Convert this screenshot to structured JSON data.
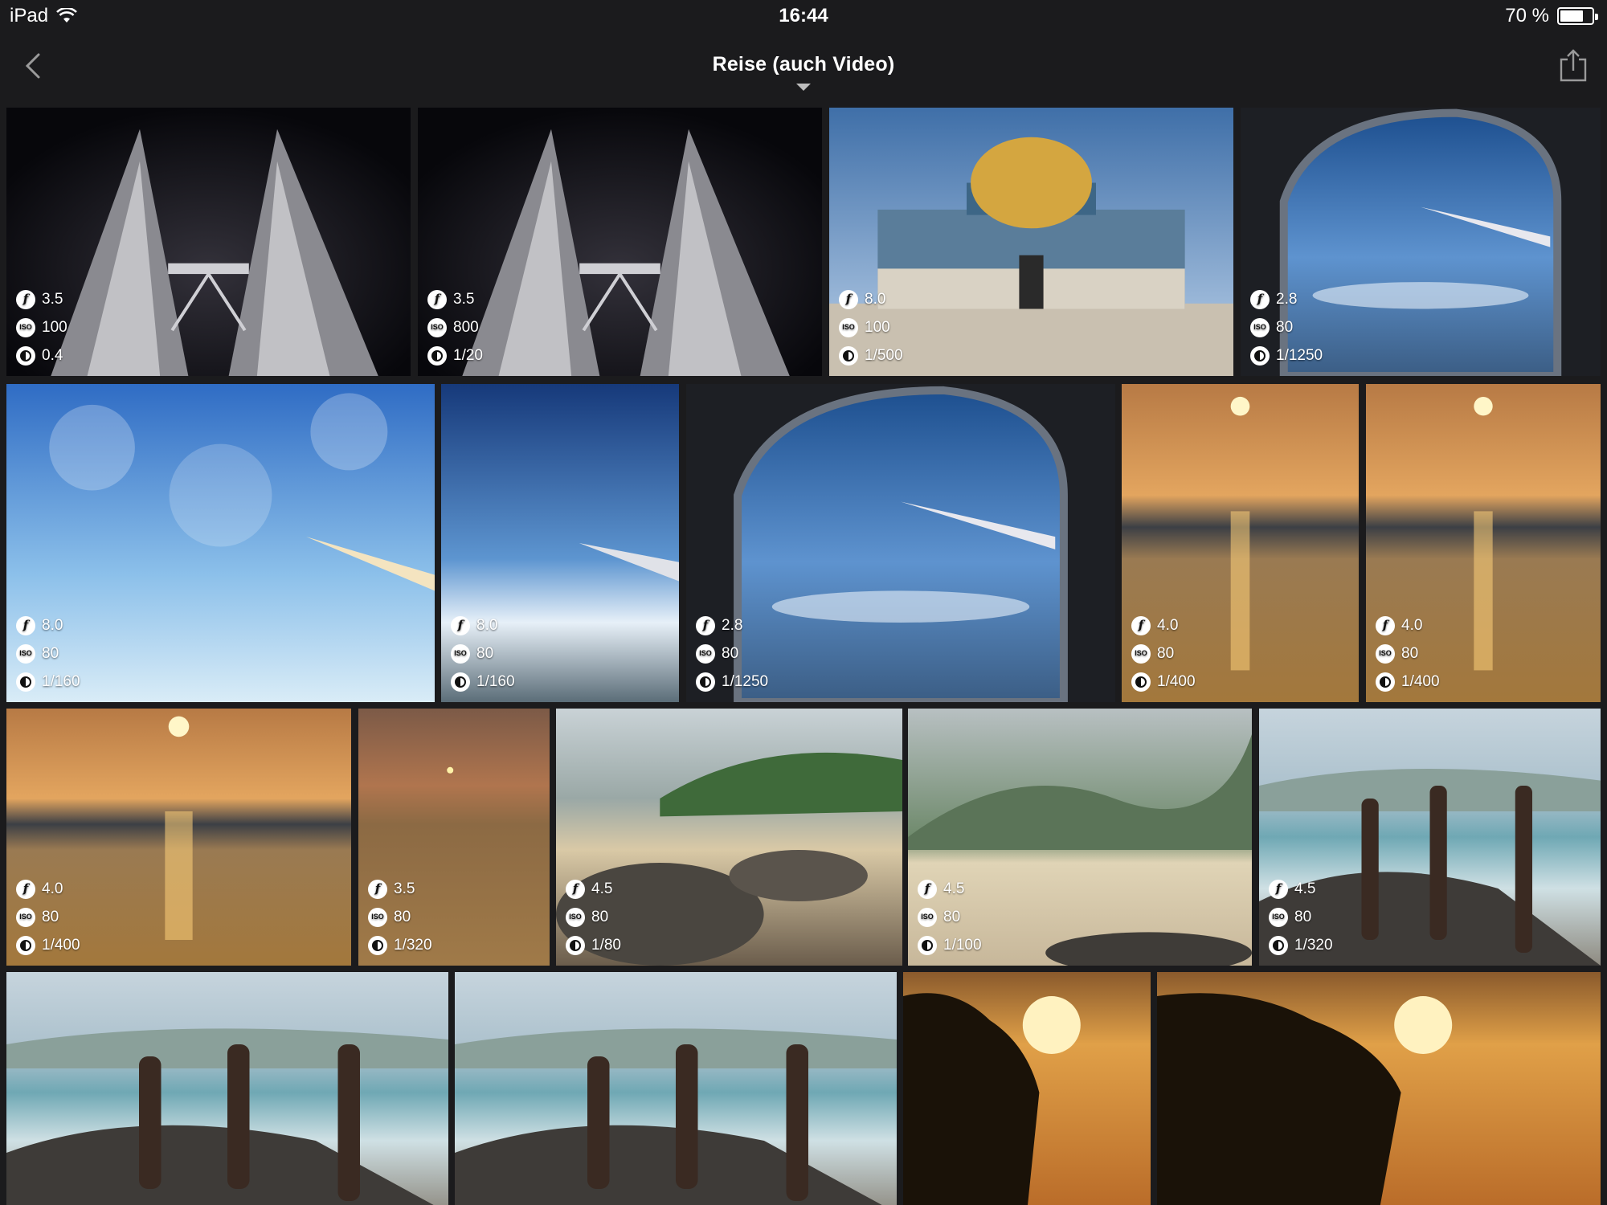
{
  "status_bar": {
    "device": "iPad",
    "time": "16:44",
    "battery": "70 %",
    "battery_level": 0.7
  },
  "nav": {
    "title": "Reise (auch Video)"
  },
  "photos": [
    {
      "aperture": "3.5",
      "iso": "100",
      "shutter": "0.4",
      "scene": "towers-night"
    },
    {
      "aperture": "3.5",
      "iso": "800",
      "shutter": "1/20",
      "scene": "towers-night"
    },
    {
      "aperture": "8.0",
      "iso": "100",
      "shutter": "1/500",
      "scene": "dome"
    },
    {
      "aperture": "2.8",
      "iso": "80",
      "shutter": "1/1250",
      "scene": "window"
    },
    {
      "aperture": "8.0",
      "iso": "80",
      "shutter": "1/160",
      "scene": "frost-sky"
    },
    {
      "aperture": "8.0",
      "iso": "80",
      "shutter": "1/160",
      "scene": "wing-sky"
    },
    {
      "aperture": "2.8",
      "iso": "80",
      "shutter": "1/1250",
      "scene": "window"
    },
    {
      "aperture": "4.0",
      "iso": "80",
      "shutter": "1/400",
      "scene": "sunset-sea"
    },
    {
      "aperture": "4.0",
      "iso": "80",
      "shutter": "1/400",
      "scene": "sunset-sea"
    },
    {
      "aperture": "4.0",
      "iso": "80",
      "shutter": "1/400",
      "scene": "sunset-sea"
    },
    {
      "aperture": "3.5",
      "iso": "80",
      "shutter": "1/320",
      "scene": "sunset-haze"
    },
    {
      "aperture": "4.5",
      "iso": "80",
      "shutter": "1/80",
      "scene": "beach-rocks"
    },
    {
      "aperture": "4.5",
      "iso": "80",
      "shutter": "1/100",
      "scene": "beach-hills"
    },
    {
      "aperture": "4.5",
      "iso": "80",
      "shutter": "1/320",
      "scene": "beach-people"
    },
    {
      "scene": "beach-people"
    },
    {
      "scene": "beach-people"
    },
    {
      "scene": "palms-sunset"
    },
    {
      "scene": "palms-sunset"
    }
  ]
}
